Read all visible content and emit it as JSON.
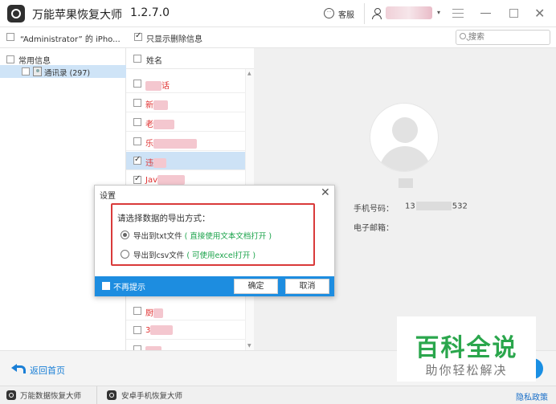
{
  "titlebar": {
    "app_title": "万能苹果恢复大师",
    "version": "1.2.7.0",
    "service_label": "客服"
  },
  "toolbar": {
    "device_label": "“Administrator” 的 iPho...",
    "only_deleted_label": "只显示删除信息",
    "search_placeholder": "搜索"
  },
  "left_panel": {
    "category_label": "常用信息",
    "contacts_label": "通讯录 (297)"
  },
  "list": {
    "header_label": "姓名",
    "rows": [
      {
        "name": "话",
        "checked": false
      },
      {
        "name": "新",
        "checked": false
      },
      {
        "name": "老",
        "checked": false
      },
      {
        "name": "乐",
        "checked": false
      },
      {
        "name": "违",
        "checked": true
      },
      {
        "name": "Jav",
        "checked": true
      }
    ],
    "rows_bottom": [
      {
        "name": "厨",
        "checked": false
      },
      {
        "name": "3",
        "checked": false
      },
      {
        "name": "",
        "checked": false
      }
    ]
  },
  "detail": {
    "phone_label": "手机号码：",
    "phone_prefix": "13",
    "phone_suffix": "532",
    "email_label": "电子邮箱："
  },
  "dialog": {
    "title": "设置",
    "prompt": "请选择数据的导出方式：",
    "option_txt": "导出到txt文件",
    "option_txt_hint": "( 直接使用文本文档打开 )",
    "option_csv": "导出到csv文件",
    "option_csv_hint": "( 可使用excel打开 )",
    "no_show_label": "不再提示",
    "ok_label": "确定",
    "cancel_label": "取消"
  },
  "watermark": {
    "title": "百科全说",
    "subtitle": "助你轻松解决"
  },
  "footer": {
    "back_label": "返回首页"
  },
  "statusbar": {
    "item1": "万能数据恢复大师",
    "item2": "安卓手机恢复大师",
    "privacy": "隐私政策"
  },
  "colors": {
    "accent_blue": "#1d8de0",
    "highlight_red": "#d93a3a",
    "hint_green": "#1aa34a",
    "watermark_green": "#2aa64c",
    "selected_row": "#cde2f6"
  }
}
